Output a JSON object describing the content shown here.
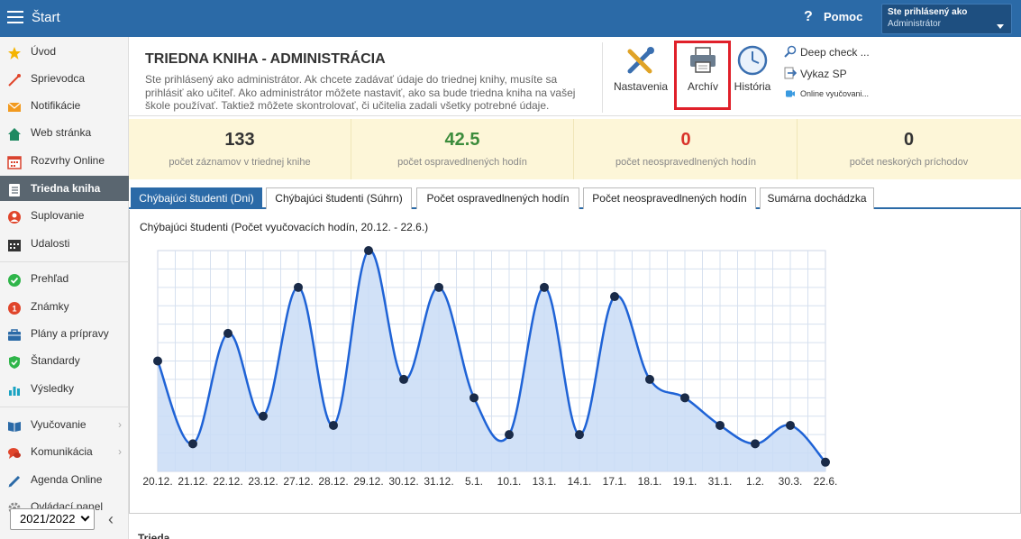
{
  "topbar": {
    "title": "Štart",
    "help_label": "Pomoc",
    "help_icon": "?",
    "user_line1": "Ste prihlásený ako",
    "user_line2": "Administrátor"
  },
  "sidebar": {
    "items": [
      {
        "label": "Úvod",
        "icon": "star-icon",
        "color": "#f5b400"
      },
      {
        "label": "Sprievodca",
        "icon": "wand-icon",
        "color": "#e0452b"
      },
      {
        "label": "Notifikácie",
        "icon": "envelope-icon",
        "color": "#f29a1f"
      },
      {
        "label": "Web stránka",
        "icon": "home-icon",
        "color": "#1f8a62"
      },
      {
        "label": "Rozvrhy Online",
        "icon": "calendar-icon",
        "color": "#d9432f"
      },
      {
        "label": "Triedna kniha",
        "icon": "book-icon",
        "color": "#ffffff"
      },
      {
        "label": "Suplovanie",
        "icon": "user-swap-icon",
        "color": "#e0452b"
      },
      {
        "label": "Udalosti",
        "icon": "events-calendar-icon",
        "color": "#333333"
      },
      {
        "label": "Prehľad",
        "icon": "check-circle-icon",
        "color": "#2fb54a"
      },
      {
        "label": "Známky",
        "icon": "grades-icon",
        "color": "#e0452b"
      },
      {
        "label": "Plány a prípravy",
        "icon": "briefcase-icon",
        "color": "#2b6aa7"
      },
      {
        "label": "Štandardy",
        "icon": "shield-check-icon",
        "color": "#2fb54a"
      },
      {
        "label": "Výsledky",
        "icon": "bar-chart-icon",
        "color": "#1aa3c2"
      },
      {
        "label": "Vyučovanie",
        "icon": "open-book-icon",
        "color": "#2b6aa7"
      },
      {
        "label": "Komunikácia",
        "icon": "chat-icon",
        "color": "#e0452b"
      },
      {
        "label": "Agenda Online",
        "icon": "pen-icon",
        "color": "#2b6aa7"
      },
      {
        "label": "Ovládací panel",
        "icon": "gear-icon",
        "color": "#888888"
      }
    ],
    "school_year": "2021/2022",
    "collapse_icon": "‹"
  },
  "header": {
    "title": "TRIEDNA KNIHA - ADMINISTRÁCIA",
    "description": "Ste prihlásený ako administrátor. Ak chcete zadávať údaje do triednej knihy, musíte sa prihlásiť ako učiteľ. Ako administrátor môžete nastaviť, ako sa bude triedna kniha na vašej škole používať. Taktiež môžete skontrolovať, či učitelia zadali všetky potrebné údaje.",
    "tools": {
      "nastavenia": "Nastavenia",
      "archiv": "Archív",
      "historia": "História"
    },
    "small_tools": {
      "deep_check": "Deep check ...",
      "vykaz_sp": "Vykaz SP",
      "online": "Online vyučovani..."
    }
  },
  "stats": [
    {
      "value": "133",
      "label": "počet záznamov v triednej knihe",
      "color": "#333333"
    },
    {
      "value": "42.5",
      "label": "počet ospravedlnených hodín",
      "color": "#3c8c3c"
    },
    {
      "value": "0",
      "label": "počet neospravedlnených hodín",
      "color": "#d9342b"
    },
    {
      "value": "0",
      "label": "počet neskorých príchodov",
      "color": "#333333"
    }
  ],
  "tabs": [
    "Chýbajúci študenti (Dni)",
    "Chýbajúci študenti (Súhrn)",
    "Počet ospravedlnených hodín",
    "Počet neospravedlnených hodín",
    "Sumárna dochádzka"
  ],
  "bottom_text": "Trieda",
  "chart_data": {
    "type": "area",
    "title": "Chýbajúci študenti (Počet vyučovacích hodín, 20.12. - 22.6.)",
    "categories": [
      "20.12.",
      "21.12.",
      "22.12.",
      "23.12.",
      "27.12.",
      "28.12.",
      "29.12.",
      "30.12.",
      "31.12.",
      "5.1.",
      "10.1.",
      "13.1.",
      "14.1.",
      "17.1.",
      "18.1.",
      "19.1.",
      "31.1.",
      "1.2.",
      "30.3.",
      "22.6."
    ],
    "values": [
      12,
      3,
      15,
      6,
      20,
      5,
      24,
      10,
      20,
      8,
      4,
      20,
      4,
      19,
      10,
      8,
      5,
      3,
      5,
      1
    ],
    "ylim": [
      0,
      24
    ],
    "grid": true,
    "color": "#1f63d6",
    "fill": "#c9dcf6"
  }
}
